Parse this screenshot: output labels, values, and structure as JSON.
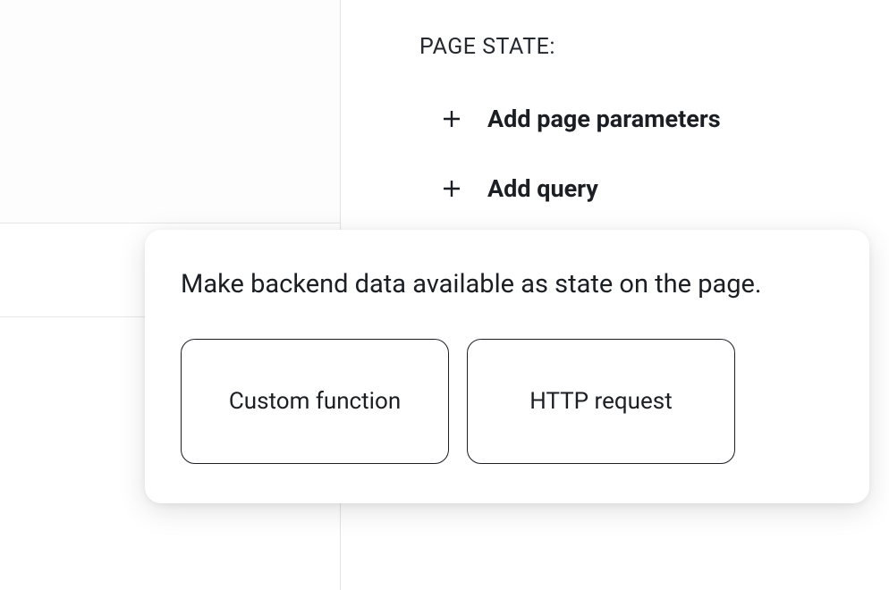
{
  "rightPanel": {
    "sectionLabel": "PAGE STATE:",
    "actions": [
      {
        "label": "Add page parameters"
      },
      {
        "label": "Add query"
      }
    ]
  },
  "popover": {
    "description": "Make backend data available as state on the page.",
    "options": [
      {
        "label": "Custom function"
      },
      {
        "label": "HTTP request"
      }
    ]
  }
}
